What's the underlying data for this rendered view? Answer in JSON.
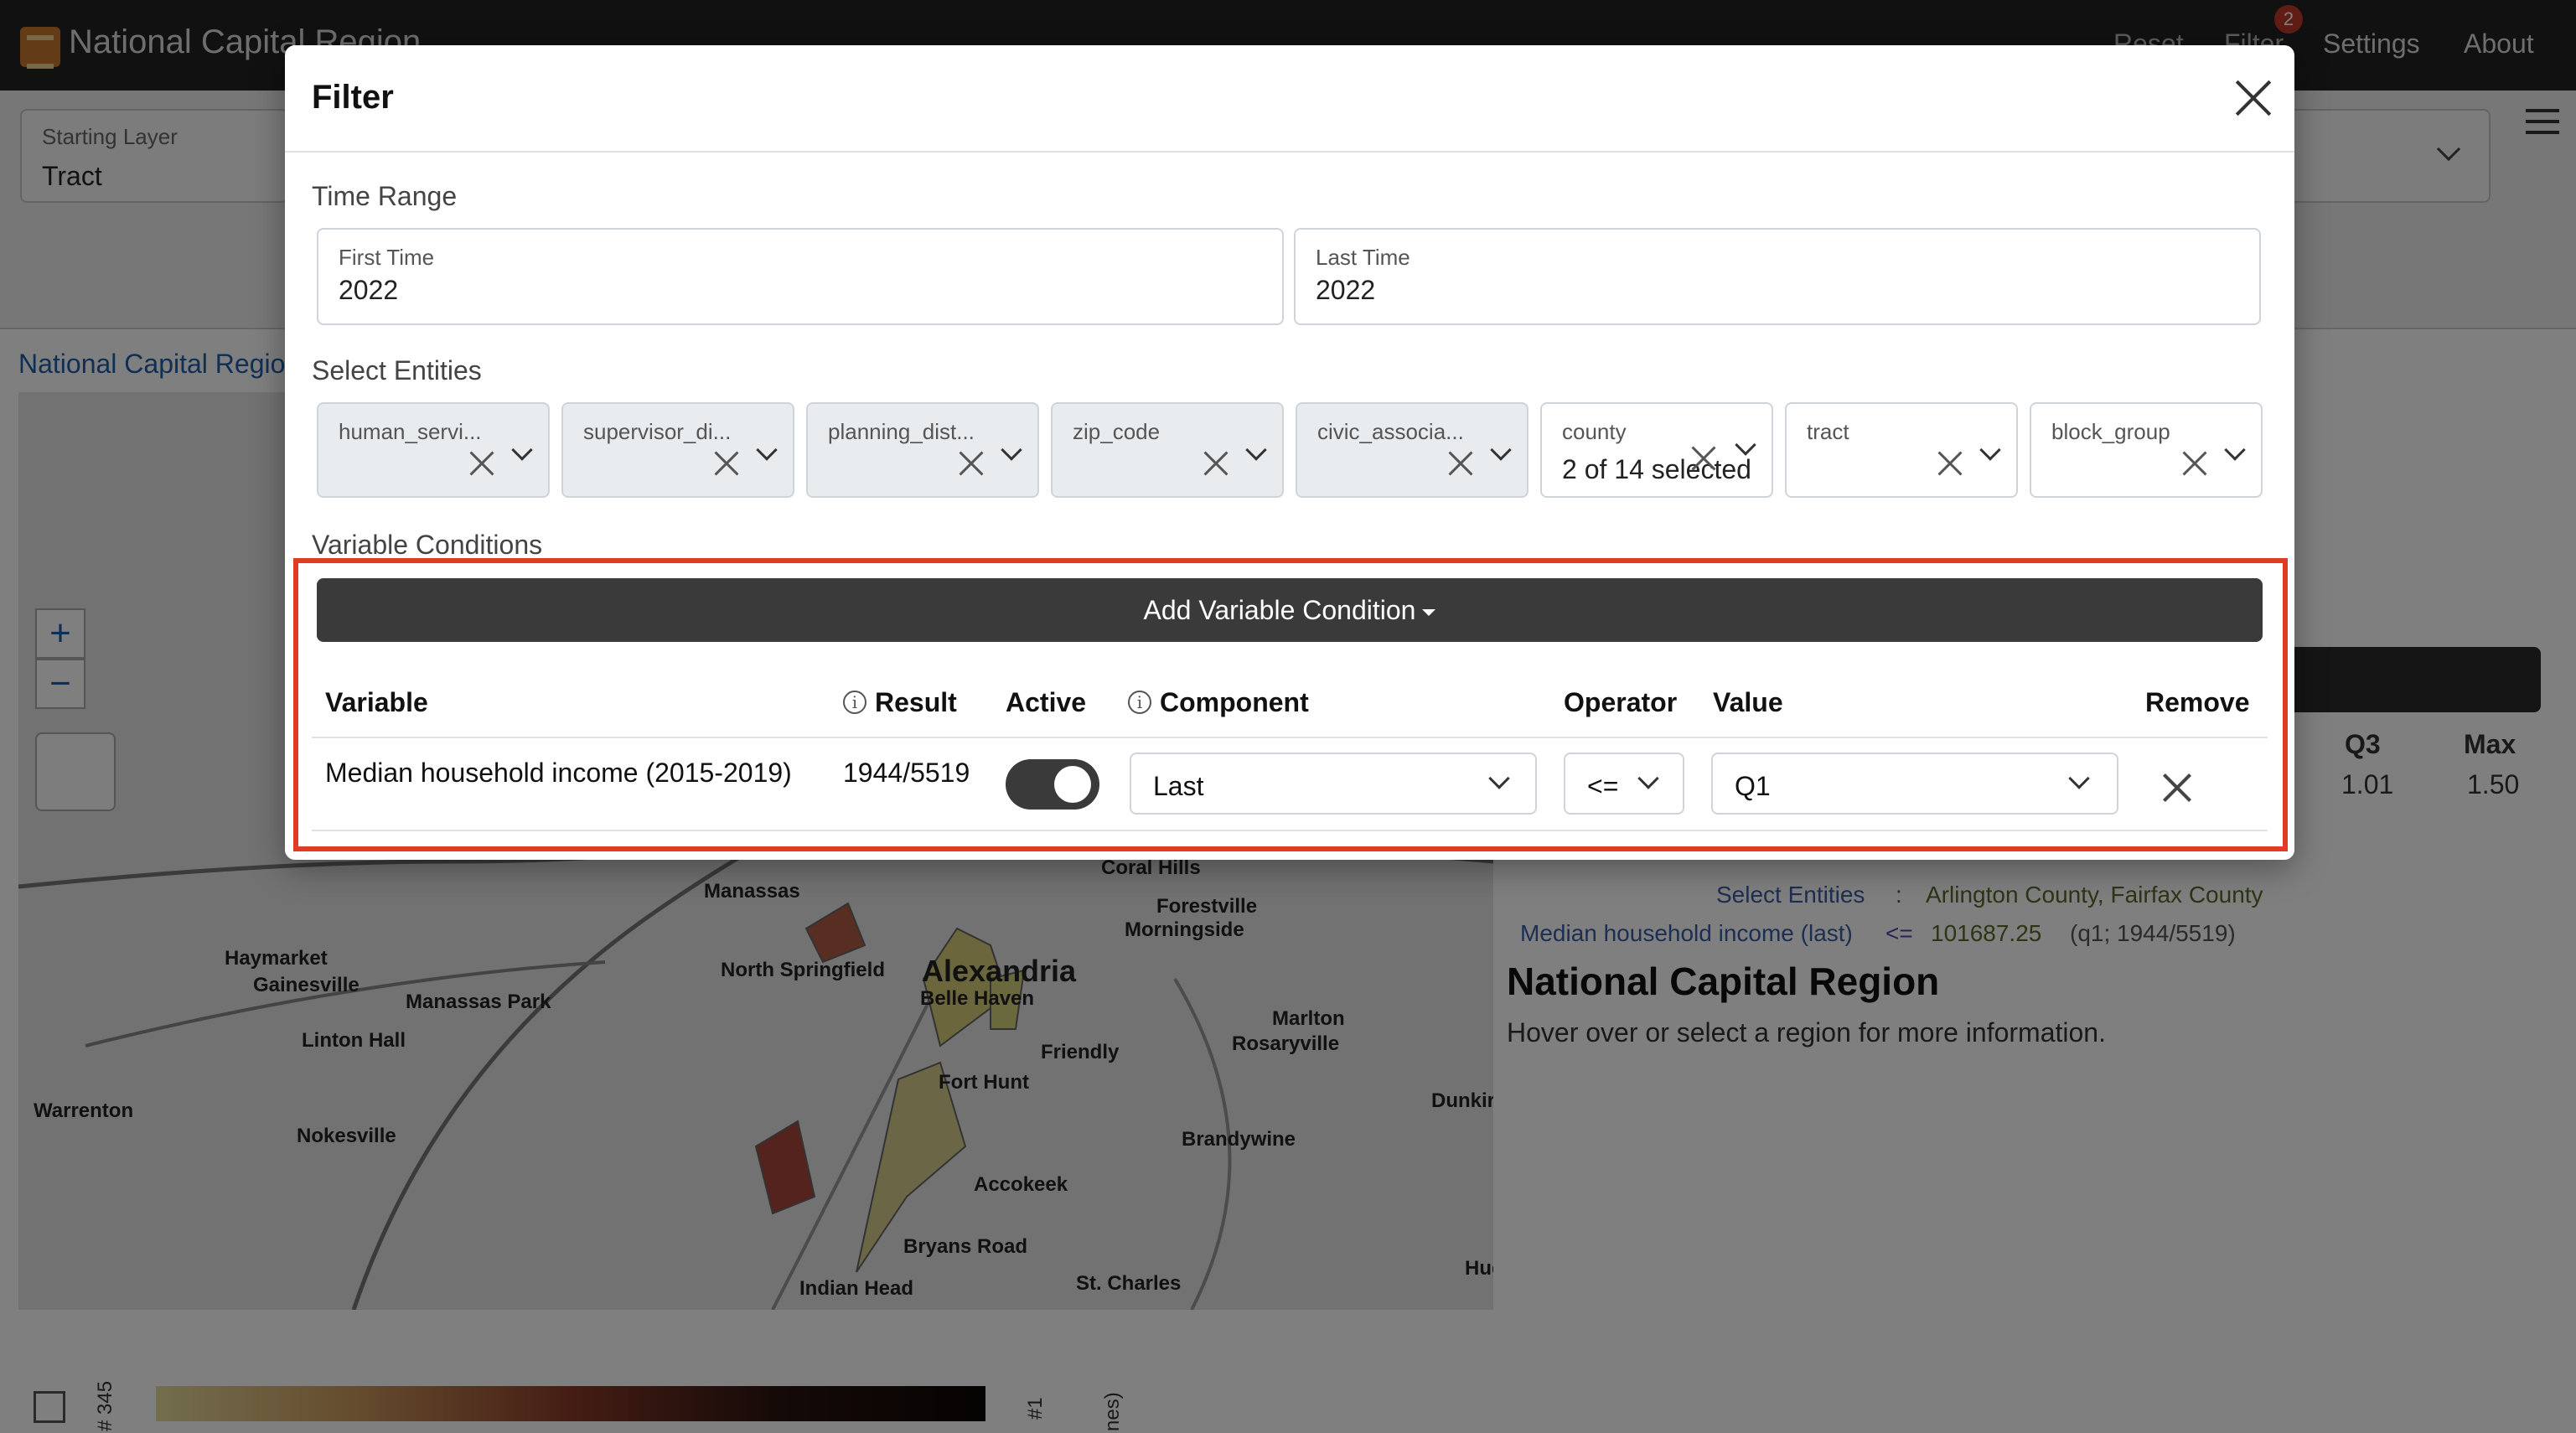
{
  "navbar": {
    "title": "National Capital Region",
    "links": {
      "reset": "Reset",
      "filter": "Filter",
      "settings": "Settings",
      "about": "About"
    },
    "filter_badge": "2",
    "icon": "region-logo-icon"
  },
  "background": {
    "starting_layer": {
      "label": "Starting Layer",
      "value": "Tract"
    },
    "breadcrumb": "National Capital Region",
    "map_labels": [
      "Coral Hills",
      "Forestville",
      "Morningside",
      "Manassas",
      "Haymarket",
      "Gainesville",
      "Manassas Park",
      "North Springfield",
      "Alexandria",
      "Belle Haven",
      "Marlton",
      "Rosaryville",
      "Friendly",
      "Linton Hall",
      "Fort Hunt",
      "Warrenton",
      "Nokesville",
      "Brandywine",
      "Accokeek",
      "Bryans Road",
      "Indian Head",
      "St. Charles",
      "Dunkirk",
      "Hughesville"
    ],
    "stats": {
      "q3_label": "Q3",
      "q3_value": "1.01",
      "max_label": "Max",
      "max_value": "1.50"
    },
    "filters_summary": {
      "entities_label": "Select Entities",
      "separator": ":",
      "entities_value": "Arlington County, Fairfax County",
      "condition_label": "Median household income (last)",
      "condition_operator": "<=",
      "condition_value": "101687.25",
      "condition_info": "(q1; 1944/5519)"
    },
    "region_title": "National Capital Region",
    "region_hint": "Hover over or select a region for more information.",
    "legend": {
      "left": "# 345",
      "right": "#1",
      "axis": "nes)"
    }
  },
  "modal": {
    "title": "Filter",
    "close_icon": "close-icon",
    "time_range": {
      "title": "Time Range",
      "first": {
        "label": "First Time",
        "value": "2022"
      },
      "last": {
        "label": "Last Time",
        "value": "2022"
      }
    },
    "entities": {
      "title": "Select Entities",
      "items": [
        {
          "label": "human_servi...",
          "value": ""
        },
        {
          "label": "supervisor_di...",
          "value": ""
        },
        {
          "label": "planning_dist...",
          "value": ""
        },
        {
          "label": "zip_code",
          "value": ""
        },
        {
          "label": "civic_associa...",
          "value": ""
        },
        {
          "label": "county",
          "value": "2 of 14 selected"
        },
        {
          "label": "tract",
          "value": ""
        },
        {
          "label": "block_group",
          "value": ""
        }
      ]
    },
    "conditions": {
      "title": "Variable Conditions",
      "add_button": "Add Variable Condition",
      "headers": {
        "variable": "Variable",
        "result": "Result",
        "active": "Active",
        "component": "Component",
        "operator": "Operator",
        "value": "Value",
        "remove": "Remove"
      },
      "rows": [
        {
          "variable": "Median household income (2015-2019)",
          "result": "1944/5519",
          "active": true,
          "component": "Last",
          "operator": "<=",
          "value": "Q1"
        }
      ]
    },
    "highlight_color": "#e23b25"
  }
}
